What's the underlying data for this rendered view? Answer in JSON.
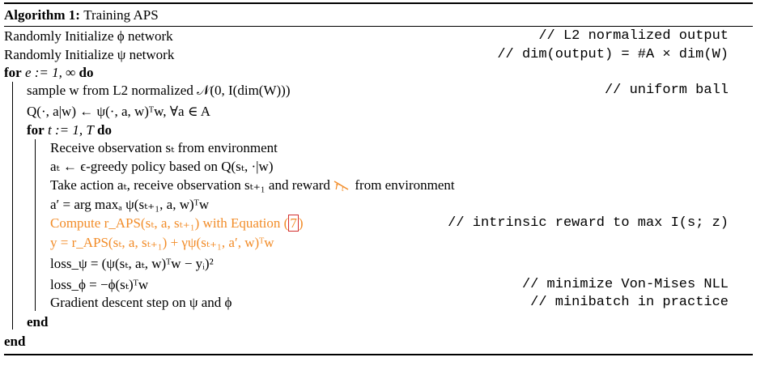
{
  "algorithm": {
    "header": "Algorithm 1:",
    "name": "Training APS"
  },
  "lines": {
    "l1": "Randomly Initialize ϕ network",
    "l1_comment": "// L2 normalized output",
    "l2": "Randomly Initialize ψ network",
    "l2_comment": "// dim(output) = #A × dim(W)",
    "l3_kw1": "for",
    "l3_body": "e := 1, ∞",
    "l3_kw2": "do",
    "l4": "sample w from L2 normalized 𝒩(0, I(dim(W)))",
    "l4_comment": "// uniform ball",
    "l5": "Q(·, a|w) ← ψ(·, a, w)ᵀw, ∀a ∈ A",
    "l6_kw1": "for",
    "l6_body": "t := 1, T",
    "l6_kw2": "do",
    "l7": "Receive observation sₜ from environment",
    "l8": "aₜ ← ϵ-greedy policy based on Q(sₜ, ·|w)",
    "l9_a": "Take action aₜ, receive observation sₜ₊₁ and reward",
    "l9_b": "from environment",
    "l10": "a′ = arg maxₐ ψ(sₜ₊₁, a, w)ᵀw",
    "l11_a": "Compute r_APS(sₜ, a, sₜ₊₁) with Equation (",
    "l11_ref": "7",
    "l11_b": ")",
    "l11_comment": "// intrinsic reward to max I(s; z)",
    "l12": "y = r_APS(sₜ, a, sₜ₊₁) + γψ(sₜ₊₁, a′, w)ᵀw",
    "l13": "loss_ψ = (ψ(sₜ, aₜ, w)ᵀw − yᵢ)²",
    "l14": "loss_ϕ = −ϕ(sₜ)ᵀw",
    "l14_comment": "// minimize Von-Mises NLL",
    "l15": "Gradient descent step on ψ and ϕ",
    "l15_comment": "// minibatch in practice",
    "l16_kw": "end",
    "l17_kw": "end"
  },
  "colors": {
    "highlight": "#f28c28",
    "ref_box": "#d32f2f"
  }
}
